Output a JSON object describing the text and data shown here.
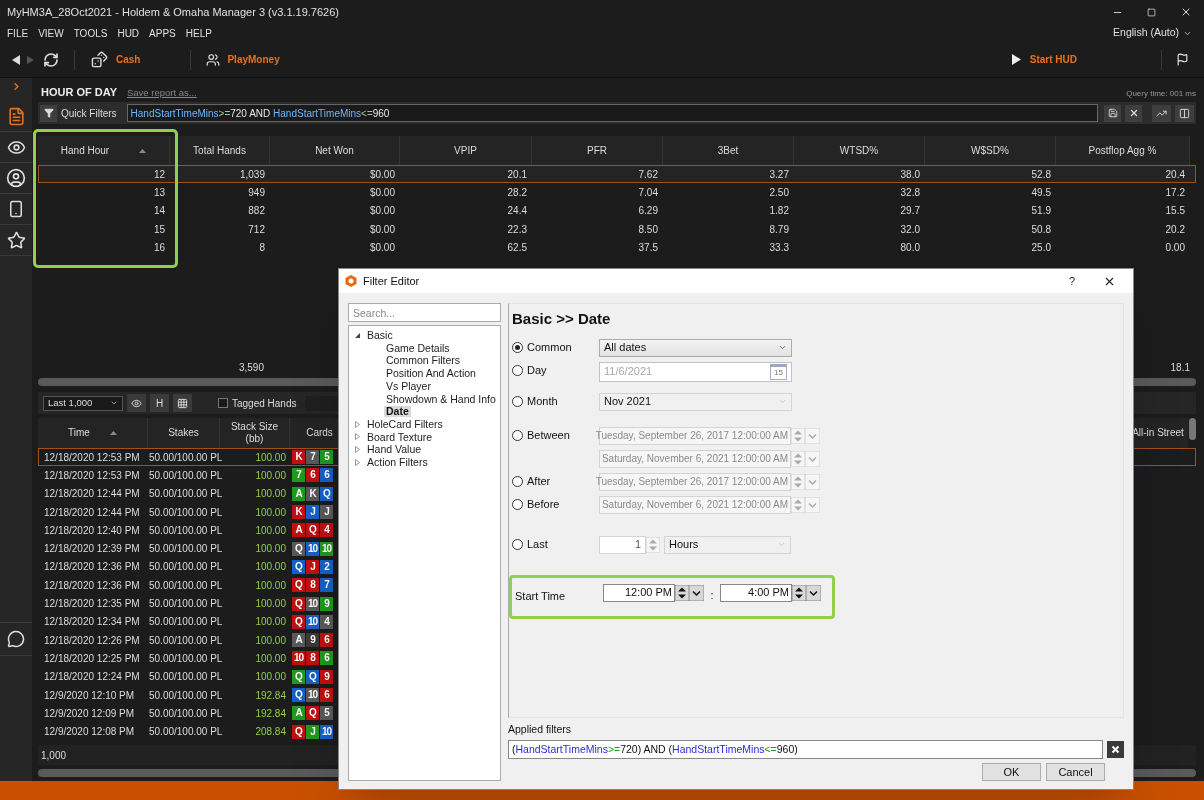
{
  "window": {
    "title": "MyHM3A_28Oct2021 - Holdem & Omaha Manager 3 (v3.1.19.7626)"
  },
  "menu": [
    "FILE",
    "VIEW",
    "TOOLS",
    "HUD",
    "APPS",
    "HELP"
  ],
  "language": "English (Auto)",
  "toolbar": {
    "cash": "Cash",
    "play_money": "PlayMoney",
    "start_hud": "Start HUD"
  },
  "report": {
    "title": "HOUR OF DAY",
    "save_link": "Save report as...",
    "query_time": "Query time: 001 ms"
  },
  "quick_filters": {
    "label": "Quick Filters",
    "tokens": [
      {
        "kind": "field",
        "text": "HandStartTimeMins"
      },
      {
        "kind": "op",
        "text": ">="
      },
      {
        "kind": "text",
        "text": "720 AND "
      },
      {
        "kind": "field",
        "text": "HandStartTimeMins"
      },
      {
        "kind": "op",
        "text": "<="
      },
      {
        "kind": "text",
        "text": "960"
      }
    ]
  },
  "hour_table": {
    "columns": [
      {
        "label": "Hand Hour",
        "sorted": true
      },
      {
        "label": "Total Hands",
        "sorted": false
      },
      {
        "label": "Net Won",
        "sorted": false
      },
      {
        "label": "VPIP",
        "sorted": false
      },
      {
        "label": "PFR",
        "sorted": false
      },
      {
        "label": "3Bet",
        "sorted": false
      },
      {
        "label": "WTSD%",
        "sorted": false
      },
      {
        "label": "W$SD%",
        "sorted": false
      },
      {
        "label": "Postflop Agg %",
        "sorted": false
      }
    ],
    "rows": [
      {
        "selected": true,
        "cells": [
          "12",
          "1,039",
          "$0.00",
          "20.1",
          "7.62",
          "3.27",
          "38.0",
          "52.8",
          "20.4"
        ]
      },
      {
        "selected": false,
        "cells": [
          "13",
          "949",
          "$0.00",
          "28.2",
          "7.04",
          "2.50",
          "32.8",
          "49.5",
          "17.2"
        ]
      },
      {
        "selected": false,
        "cells": [
          "14",
          "882",
          "$0.00",
          "24.4",
          "6.29",
          "1.82",
          "29.7",
          "51.9",
          "15.5"
        ]
      },
      {
        "selected": false,
        "cells": [
          "15",
          "712",
          "$0.00",
          "22.3",
          "8.50",
          "8.79",
          "32.0",
          "50.8",
          "20.2"
        ]
      },
      {
        "selected": false,
        "cells": [
          "16",
          "8",
          "$0.00",
          "62.5",
          "37.5",
          "33.3",
          "80.0",
          "25.0",
          "0.00"
        ]
      }
    ],
    "totals": {
      "total_hands": "3,590",
      "postflop_agg": "18.1"
    }
  },
  "hands_toolbar": {
    "range": "Last 1,000",
    "h_button": "H",
    "tagged_hands": {
      "label": "Tagged Hands",
      "checked": false
    }
  },
  "hands_table": {
    "columns": [
      {
        "label": "Time",
        "sorted": true
      },
      {
        "label": "Stakes",
        "sorted": false
      },
      {
        "label": "Stack Size (bb)",
        "sorted": false
      },
      {
        "label": "Cards",
        "sorted": false
      },
      {
        "label": "All-in Street",
        "sorted": false
      }
    ],
    "rows": [
      {
        "selected": true,
        "time": "12/18/2020 12:53 PM",
        "stakes": "50.00/100.00 PL",
        "stack": "100.00",
        "cards": [
          {
            "rank": "K",
            "color": "#c01010"
          },
          {
            "rank": "7",
            "color": "#5a5a5a"
          },
          {
            "rank": "5",
            "color": "#1f9a1f"
          }
        ]
      },
      {
        "selected": false,
        "time": "12/18/2020 12:53 PM",
        "stakes": "50.00/100.00 PL",
        "stack": "100.00",
        "cards": [
          {
            "rank": "7",
            "color": "#1f9a1f"
          },
          {
            "rank": "6",
            "color": "#c01010"
          },
          {
            "rank": "6",
            "color": "#1560c8"
          }
        ]
      },
      {
        "selected": false,
        "time": "12/18/2020 12:44 PM",
        "stakes": "50.00/100.00 PL",
        "stack": "100.00",
        "cards": [
          {
            "rank": "A",
            "color": "#1f9a1f"
          },
          {
            "rank": "K",
            "color": "#5a5a5a"
          },
          {
            "rank": "Q",
            "color": "#1560c8"
          }
        ]
      },
      {
        "selected": false,
        "time": "12/18/2020 12:44 PM",
        "stakes": "50.00/100.00 PL",
        "stack": "100.00",
        "cards": [
          {
            "rank": "K",
            "color": "#c01010"
          },
          {
            "rank": "J",
            "color": "#1560c8"
          },
          {
            "rank": "J",
            "color": "#5a5a5a"
          }
        ]
      },
      {
        "selected": false,
        "time": "12/18/2020 12:40 PM",
        "stakes": "50.00/100.00 PL",
        "stack": "100.00",
        "cards": [
          {
            "rank": "A",
            "color": "#c01010"
          },
          {
            "rank": "Q",
            "color": "#c01010"
          },
          {
            "rank": "4",
            "color": "#c01010"
          }
        ]
      },
      {
        "selected": false,
        "time": "12/18/2020 12:39 PM",
        "stakes": "50.00/100.00 PL",
        "stack": "100.00",
        "cards": [
          {
            "rank": "Q",
            "color": "#5a5a5a"
          },
          {
            "rank": "10",
            "color": "#1560c8"
          },
          {
            "rank": "10",
            "color": "#1f9a1f"
          }
        ]
      },
      {
        "selected": false,
        "time": "12/18/2020 12:36 PM",
        "stakes": "50.00/100.00 PL",
        "stack": "100.00",
        "cards": [
          {
            "rank": "Q",
            "color": "#1560c8"
          },
          {
            "rank": "J",
            "color": "#c01010"
          },
          {
            "rank": "2",
            "color": "#1560c8"
          }
        ]
      },
      {
        "selected": false,
        "time": "12/18/2020 12:36 PM",
        "stakes": "50.00/100.00 PL",
        "stack": "100.00",
        "cards": [
          {
            "rank": "Q",
            "color": "#c01010"
          },
          {
            "rank": "8",
            "color": "#c01010"
          },
          {
            "rank": "7",
            "color": "#1560c8"
          }
        ]
      },
      {
        "selected": false,
        "time": "12/18/2020 12:35 PM",
        "stakes": "50.00/100.00 PL",
        "stack": "100.00",
        "cards": [
          {
            "rank": "Q",
            "color": "#c01010"
          },
          {
            "rank": "10",
            "color": "#5a5a5a"
          },
          {
            "rank": "9",
            "color": "#1f9a1f"
          }
        ]
      },
      {
        "selected": false,
        "time": "12/18/2020 12:34 PM",
        "stakes": "50.00/100.00 PL",
        "stack": "100.00",
        "cards": [
          {
            "rank": "Q",
            "color": "#c01010"
          },
          {
            "rank": "10",
            "color": "#1560c8"
          },
          {
            "rank": "4",
            "color": "#5a5a5a"
          }
        ]
      },
      {
        "selected": false,
        "time": "12/18/2020 12:26 PM",
        "stakes": "50.00/100.00 PL",
        "stack": "100.00",
        "cards": [
          {
            "rank": "A",
            "color": "#5a5a5a"
          },
          {
            "rank": "9",
            "color": "#3a3a3a"
          },
          {
            "rank": "6",
            "color": "#c01010"
          }
        ]
      },
      {
        "selected": false,
        "time": "12/18/2020 12:25 PM",
        "stakes": "50.00/100.00 PL",
        "stack": "100.00",
        "cards": [
          {
            "rank": "10",
            "color": "#c01010"
          },
          {
            "rank": "8",
            "color": "#c01010"
          },
          {
            "rank": "6",
            "color": "#1f9a1f"
          }
        ]
      },
      {
        "selected": false,
        "time": "12/18/2020 12:24 PM",
        "stakes": "50.00/100.00 PL",
        "stack": "100.00",
        "cards": [
          {
            "rank": "Q",
            "color": "#1f9a1f"
          },
          {
            "rank": "Q",
            "color": "#1560c8"
          },
          {
            "rank": "9",
            "color": "#c01010"
          }
        ]
      },
      {
        "selected": false,
        "time": "12/9/2020 12:10 PM",
        "stakes": "50.00/100.00 PL",
        "stack": "192.84",
        "cards": [
          {
            "rank": "Q",
            "color": "#1560c8"
          },
          {
            "rank": "10",
            "color": "#5a5a5a"
          },
          {
            "rank": "6",
            "color": "#c01010"
          }
        ]
      },
      {
        "selected": false,
        "time": "12/9/2020 12:09 PM",
        "stakes": "50.00/100.00 PL",
        "stack": "192.84",
        "cards": [
          {
            "rank": "A",
            "color": "#1f9a1f"
          },
          {
            "rank": "Q",
            "color": "#c01010"
          },
          {
            "rank": "5",
            "color": "#5a5a5a"
          }
        ]
      },
      {
        "selected": false,
        "time": "12/9/2020 12:08 PM",
        "stakes": "50.00/100.00 PL",
        "stack": "208.84",
        "cards": [
          {
            "rank": "Q",
            "color": "#c01010"
          },
          {
            "rank": "J",
            "color": "#1f9a1f"
          },
          {
            "rank": "10",
            "color": "#1560c8"
          }
        ]
      }
    ],
    "footer": "1,000"
  },
  "filter_editor": {
    "title": "Filter Editor",
    "help": "?",
    "search": {
      "placeholder": "Search..."
    },
    "tree": [
      {
        "label": "Basic",
        "expanded": true,
        "selected": false,
        "children": [
          {
            "label": "Game Details",
            "selected": false
          },
          {
            "label": "Common Filters",
            "selected": false
          },
          {
            "label": "Position And Action",
            "selected": false
          },
          {
            "label": "Vs Player",
            "selected": false
          },
          {
            "label": "Showdown & Hand Info",
            "selected": false
          },
          {
            "label": "Date",
            "selected": true
          }
        ]
      },
      {
        "label": "HoleCard Filters",
        "expanded": false,
        "selected": false
      },
      {
        "label": "Board Texture",
        "expanded": false,
        "selected": false
      },
      {
        "label": "Hand Value",
        "expanded": false,
        "selected": false
      },
      {
        "label": "Action Filters",
        "expanded": false,
        "selected": false
      }
    ],
    "heading": "Basic >> Date",
    "options": [
      {
        "label": "Common",
        "selected": true,
        "kind": "select",
        "value": "All dates"
      },
      {
        "label": "Day",
        "selected": false,
        "kind": "date",
        "value": "11/6/2021",
        "calendar_day": "15"
      },
      {
        "label": "Month",
        "selected": false,
        "kind": "select",
        "value": "Nov 2021"
      },
      {
        "label": "Between",
        "selected": false,
        "kind": "datetime",
        "values": [
          "Tuesday, September 26, 2017 12:00:00 AM",
          "Saturday, November 6, 2021 12:00:00 AM"
        ]
      },
      {
        "label": "After",
        "selected": false,
        "kind": "datetime",
        "values": [
          "Tuesday, September 26, 2017 12:00:00 AM"
        ]
      },
      {
        "label": "Before",
        "selected": false,
        "kind": "datetime",
        "values": [
          "Saturday, November 6, 2021 12:00:00 AM"
        ]
      },
      {
        "label": "Last",
        "selected": false,
        "kind": "last",
        "number": "1",
        "unit": "Hours"
      }
    ],
    "start_time": {
      "label": "Start Time",
      "from": "12:00 PM",
      "separator": ":",
      "to": "4:00 PM"
    },
    "applied": {
      "label": "Applied filters",
      "tokens": [
        {
          "kind": "text",
          "text": "("
        },
        {
          "kind": "field",
          "text": "HandStartTimeMins"
        },
        {
          "kind": "op",
          "text": ">="
        },
        {
          "kind": "text",
          "text": "720) AND ("
        },
        {
          "kind": "field",
          "text": "HandStartTimeMins"
        },
        {
          "kind": "op",
          "text": "<="
        },
        {
          "kind": "text",
          "text": "960)"
        }
      ]
    },
    "buttons": [
      "OK",
      "Cancel"
    ]
  }
}
